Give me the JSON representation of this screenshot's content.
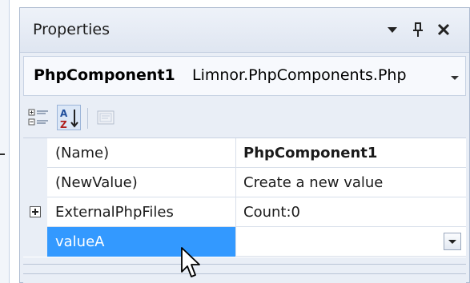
{
  "panel": {
    "title": "Properties",
    "titlebar_icons": [
      "dropdown-arrow-icon",
      "pin-icon",
      "close-icon"
    ]
  },
  "selector": {
    "object_name": "PhpComponent1",
    "object_type": "Limnor.PhpComponents.Php"
  },
  "toolbar": {
    "icons": [
      "categorized-icon",
      "alphabetical-sort-icon",
      "property-pages-icon"
    ]
  },
  "grid": {
    "rows": [
      {
        "name": "(Name)",
        "value": "PhpComponent1",
        "bold_value": true,
        "expandable": false,
        "selected": false
      },
      {
        "name": "(NewValue)",
        "value": "Create a new value",
        "bold_value": false,
        "expandable": false,
        "selected": false
      },
      {
        "name": "ExternalPhpFiles",
        "value": "Count:0",
        "bold_value": false,
        "expandable": true,
        "selected": false
      },
      {
        "name": "valueA",
        "value": "",
        "bold_value": false,
        "expandable": false,
        "selected": true
      }
    ]
  },
  "colors": {
    "selection": "#3399ff",
    "panel_background": "#e9eef6",
    "border": "#aebcd1"
  }
}
